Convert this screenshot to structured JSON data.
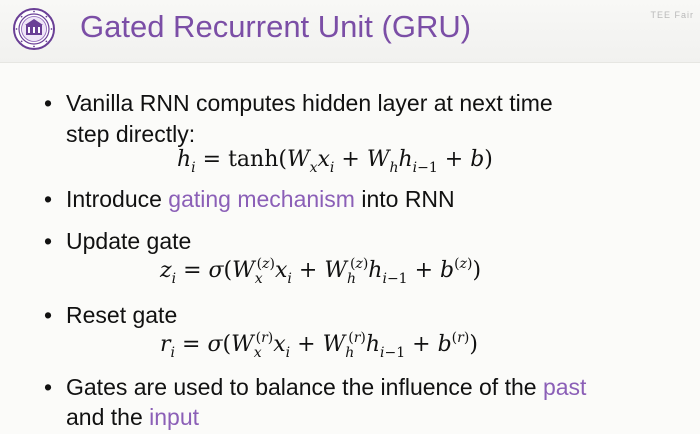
{
  "title": "Gated Recurrent Unit (GRU)",
  "watermark": "TEE Fair",
  "bullets": [
    {
      "line1": "Vanilla RNN computes hidden layer at next time",
      "line2": "step directly:"
    },
    {
      "before": "Introduce ",
      "highlight": "gating mechanism",
      "after": " into RNN"
    },
    {
      "text": "Update gate"
    },
    {
      "text": "Reset gate"
    },
    {
      "line1_before": "Gates are used to balance the influence of the ",
      "line1_highlight": "past",
      "line2_before": "and the ",
      "line2_highlight": "input"
    }
  ],
  "colors": {
    "title": "#7b4ea6",
    "highlight": "#8b5fb7"
  }
}
